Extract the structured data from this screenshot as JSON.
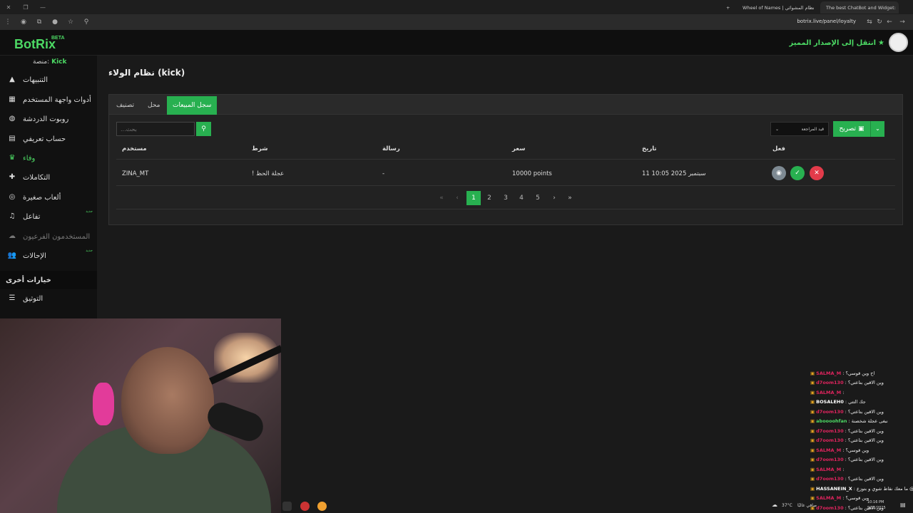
{
  "browser": {
    "tabs": [
      {
        "label": "Wheel of Names | نظام المشوائي"
      },
      {
        "label": "The best ChatBot and Widget:"
      }
    ],
    "url": "botrix.live/panel/loyalty"
  },
  "header": {
    "logo": "BotRix",
    "beta": "BETA",
    "premium_link": "انتقل إلى الإصدار المميز"
  },
  "sidebar": {
    "platform_label": "منصة:",
    "platform_value": "Kick",
    "items": [
      {
        "label": "التنبيهات",
        "icon": "alert-icon"
      },
      {
        "label": "أدوات واجهة المستخدم",
        "icon": "widgets-icon"
      },
      {
        "label": "روبوت الدردشة",
        "icon": "robot-icon"
      },
      {
        "label": "حساب تعريفي",
        "icon": "id-card-icon"
      },
      {
        "label": "وفاء",
        "icon": "trophy-icon"
      },
      {
        "label": "التكاملات",
        "icon": "puzzle-icon"
      },
      {
        "label": "ألعاب صغيرة",
        "icon": "gamepad-icon"
      },
      {
        "label": "تفاعل",
        "icon": "music-icon",
        "badge": "جديد"
      },
      {
        "label": "المستخدمون الفرعيون",
        "icon": "users-icon"
      },
      {
        "label": "الإحالات",
        "icon": "referral-icon",
        "badge": "جديد"
      }
    ],
    "section_title": "خيارات أخرى",
    "extra_items": [
      {
        "label": "التوثيق",
        "icon": "docs-icon"
      }
    ]
  },
  "main": {
    "page_title": "نظام الولاء (kick)",
    "tabs": [
      "سجل المبيعات",
      "محل",
      "تصنيف"
    ],
    "search_placeholder": "...بحث",
    "sort_select": "قيد المراجعة",
    "export_label": "تصريح",
    "table": {
      "headers": [
        "فعل",
        "تاريخ",
        "سعر",
        "رسالة",
        "شرط",
        "مستخدم"
      ],
      "rows": [
        {
          "date": "11 سبتمبر 2025 10:05",
          "price": "10000 points",
          "message": "-",
          "condition": "! عجلة الحظ",
          "user": "ZINA_MT"
        }
      ]
    },
    "pagination": [
      "1",
      "2",
      "3",
      "4",
      "5"
    ]
  },
  "chat": {
    "messages": [
      {
        "user": "SALMA_M",
        "text": "اح وين قوسي؟",
        "color": "#e0245e"
      },
      {
        "user": "d7oom130",
        "text": "وين الاقين بتاعتي؟",
        "color": "#e0245e"
      },
      {
        "user": "SALMA_M",
        "text": "",
        "color": "#e0245e"
      },
      {
        "user": "BOSALEH0",
        "text": "جك التتي",
        "color": "#ffffff"
      },
      {
        "user": "d7oom130",
        "text": "وين الاقين بتاعتي؟",
        "color": "#e0245e"
      },
      {
        "user": "aboooohfan",
        "text": "نبغى عجلة شخصنة",
        "color": "#4cd964"
      },
      {
        "user": "d7oom130",
        "text": "وين الاقين بتاعتي؟",
        "color": "#e0245e"
      },
      {
        "user": "d7oom130",
        "text": "وين الاقين بتاعتي؟",
        "color": "#e0245e"
      },
      {
        "user": "SALMA_M",
        "text": "وين قوسي؟",
        "color": "#e0245e"
      },
      {
        "user": "d7oom130",
        "text": "وين الاقين بتاعتي؟",
        "color": "#e0245e"
      },
      {
        "user": "SALMA_M",
        "text": "",
        "color": "#e0245e"
      },
      {
        "user": "d7oom130",
        "text": "وين الاقين بتاعتي؟",
        "color": "#e0245e"
      },
      {
        "user": "HASSANEIN_X",
        "text": "ما معك نقاط شوي و بتوزع @",
        "color": "#ffffff"
      },
      {
        "user": "SALMA_M",
        "text": "وين قوسي؟",
        "color": "#e0245e"
      },
      {
        "user": "d7oom130",
        "text": "وين الاقين بتاعتي؟",
        "color": "#e0245e"
      }
    ]
  },
  "taskbar": {
    "weather": "37°C",
    "weather_text": "صافي غالبًا",
    "time": "10:16 PM",
    "date": "9/11/2025"
  },
  "colors": {
    "accent": "#28b050",
    "brand": "#4cd964"
  }
}
